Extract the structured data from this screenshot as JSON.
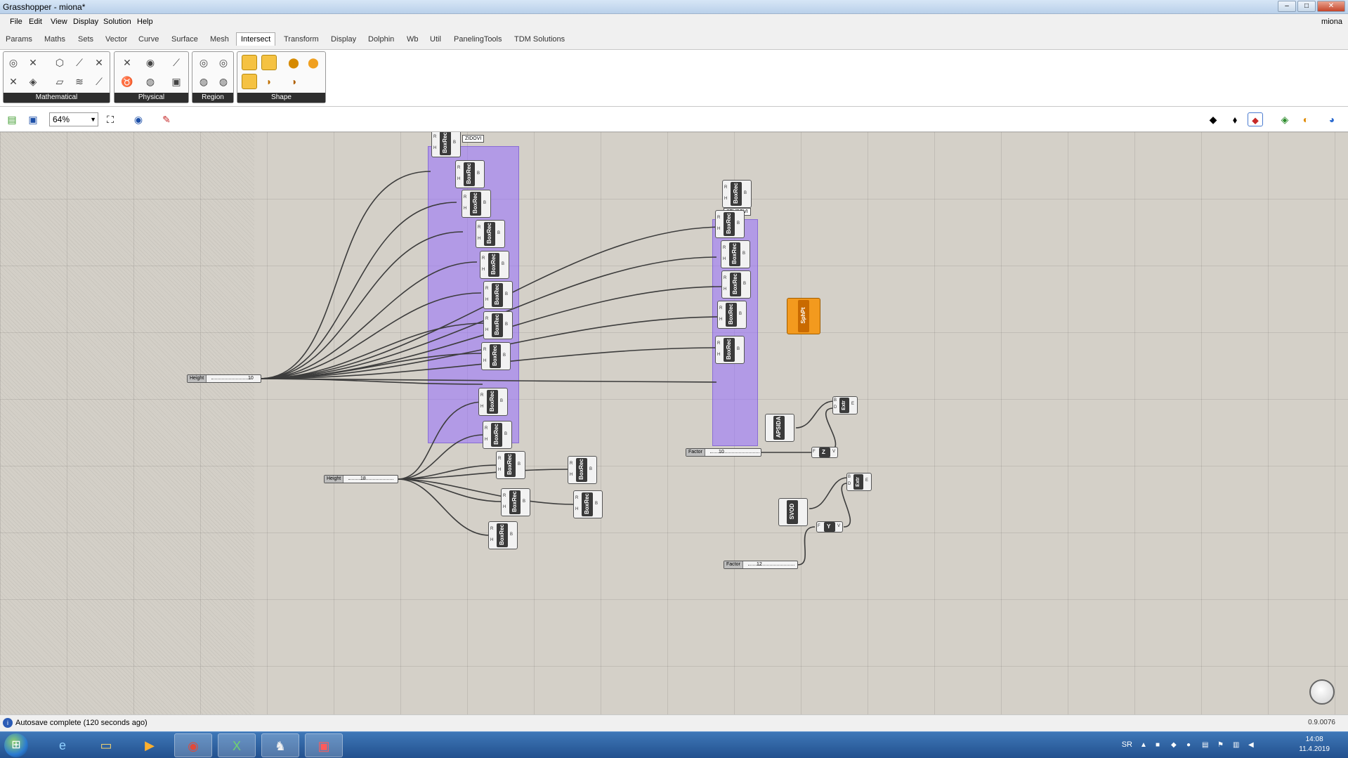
{
  "window": {
    "title": "Grasshopper - miona*",
    "min_symbol": "–",
    "max_symbol": "□",
    "close_symbol": "✕"
  },
  "menu": {
    "items": [
      "File",
      "Edit",
      "View",
      "Display",
      "Solution",
      "Help"
    ],
    "user": "miona"
  },
  "tabs": {
    "items": [
      "Params",
      "Maths",
      "Sets",
      "Vector",
      "Curve",
      "Surface",
      "Mesh",
      "Intersect",
      "Transform",
      "Display",
      "Dolphin",
      "Wb",
      "Util",
      "PanelingTools",
      "TDM Solutions"
    ],
    "active": "Intersect"
  },
  "ribbon": {
    "panels": [
      "Mathematical",
      "Physical",
      "Region",
      "Shape"
    ]
  },
  "toolbar": {
    "zoom": "64%"
  },
  "canvas": {
    "groups": [
      "ZIDOVI",
      "STUBOVI"
    ],
    "sliders": [
      {
        "label": "Height",
        "value": "10"
      },
      {
        "label": "Height",
        "value": "18"
      },
      {
        "label": "Factor",
        "value": "10"
      },
      {
        "label": "Factor",
        "value": "12"
      }
    ],
    "component_names": {
      "boxrec": "BoxRec",
      "sphpt": "SphPt",
      "apsida": "APSIDA",
      "svod": "SVOD",
      "extr": "Extr",
      "z": "Z",
      "y": "Y"
    },
    "pins": {
      "boxrec_in1": "R",
      "boxrec_in2": "H",
      "boxrec_out": "B",
      "extr_in1": "B",
      "extr_in2": "D",
      "extr_out": "E",
      "vec_in": "F",
      "vec_out": "V"
    },
    "version": "0.9.0076"
  },
  "status": {
    "message": "Autosave complete (120 seconds ago)"
  },
  "taskbar": {
    "language": "SR",
    "time": "14:08",
    "date": "11.4.2019"
  },
  "colors": {
    "group": "#9f78ff",
    "cluster": "#f39a1e",
    "component": "#3a3a3a",
    "canvas": "#d4d0c8"
  }
}
